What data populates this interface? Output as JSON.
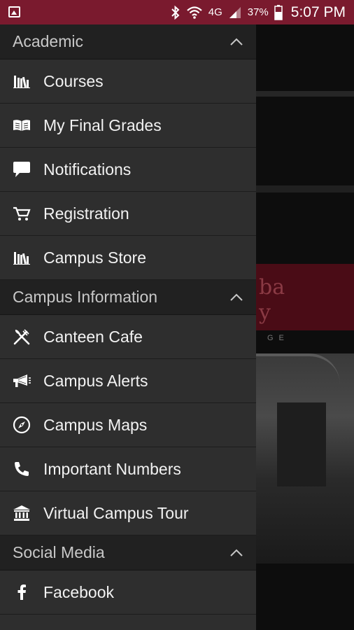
{
  "status_bar": {
    "network": "4G",
    "battery": "37%",
    "time": "5:07 PM"
  },
  "background": {
    "banner_line1": "ba",
    "banner_line2": "y",
    "banner_line3": "GE"
  },
  "drawer": {
    "sections": [
      {
        "title": "Academic",
        "items": [
          {
            "label": "Courses",
            "icon": "books-icon"
          },
          {
            "label": "My Final Grades",
            "icon": "open-book-icon"
          },
          {
            "label": "Notifications",
            "icon": "speech-bubble-icon"
          },
          {
            "label": "Registration",
            "icon": "cart-icon"
          },
          {
            "label": "Campus Store",
            "icon": "books-icon"
          }
        ]
      },
      {
        "title": "Campus Information",
        "items": [
          {
            "label": "Canteen Cafe",
            "icon": "fork-knife-icon"
          },
          {
            "label": "Campus Alerts",
            "icon": "megaphone-icon"
          },
          {
            "label": "Campus Maps",
            "icon": "compass-icon"
          },
          {
            "label": "Important Numbers",
            "icon": "phone-icon"
          },
          {
            "label": "Virtual Campus Tour",
            "icon": "museum-icon"
          }
        ]
      },
      {
        "title": "Social Media",
        "items": [
          {
            "label": "Facebook",
            "icon": "facebook-icon"
          }
        ]
      }
    ]
  },
  "colors": {
    "status_bar": "#7a1a2e",
    "drawer_bg": "#2e2e2e",
    "section_bg": "#212121"
  }
}
